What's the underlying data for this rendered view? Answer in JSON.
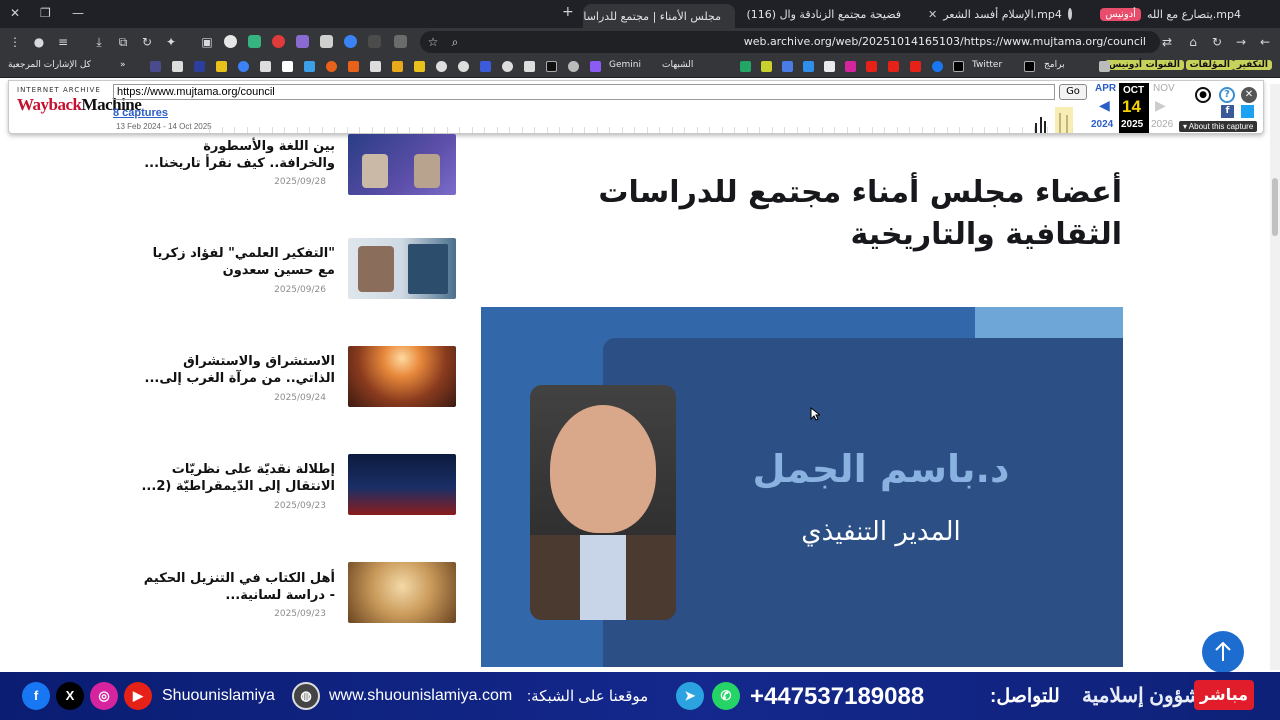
{
  "browser": {
    "tabs": [
      {
        "title": "يتصارع مع الله.mp4",
        "badge": "أدونيس"
      },
      {
        "title": "الإسلام أفسد الشعر.mp4"
      },
      {
        "title": "(116) فضيحة مجتمع الزنادقة وال"
      },
      {
        "title": "مجلس الأمناء | مجتمع للدراسات ا",
        "active": true
      }
    ],
    "new_tab": "+",
    "url": "web.archive.org/web/20251014165103/https://www.mujtama.org/council",
    "bookmarks": [
      {
        "label": "التكفير",
        "tag": true
      },
      {
        "label": "المؤلفات",
        "tag": true
      },
      {
        "label": "القنوات",
        "tag": true
      },
      {
        "label": "أدونيس",
        "tag": true
      },
      {
        "label": "برامج"
      },
      {
        "label": "Twitter"
      },
      {
        "label": "الشبهات"
      },
      {
        "label": "Gemini"
      },
      {
        "label": "كل الإشارات المرجعية"
      }
    ]
  },
  "wayback": {
    "logo_top": "INTERNET ARCHIVE",
    "logo_main_red": "Wayback",
    "logo_main_black": "Machine",
    "url_value": "https://www.mujtama.org/council",
    "go_label": "Go",
    "captures": "8 captures",
    "range": "13 Feb 2024 - 14 Oct 2025",
    "prev_month": "APR",
    "cur_month": "OCT",
    "next_month": "NOV",
    "cur_day": "14",
    "prev_year": "2024",
    "cur_year": "2025",
    "next_year": "2026",
    "about": "About this capture"
  },
  "sidebar": {
    "items": [
      {
        "title": "بين اللغة والأسطورة والخرافة.. كيف نقرأ تاريخنا...",
        "date": "2025/09/28"
      },
      {
        "title": "\"التفكير العلمي\" لفؤاد زكريا مع حسين سعدون",
        "date": "2025/09/26"
      },
      {
        "title": "الاستشراق والاستشراق الذاتي.. من مرآة الغرب إلى...",
        "date": "2025/09/24"
      },
      {
        "title": "إطلالة نقديّة على نظريّات الانتقال إلى الدّيمقراطيّة (2...",
        "date": "2025/09/23"
      },
      {
        "title": "أهل الكتاب في التنزيل الحكيم - دراسة لسانية...",
        "date": "2025/09/23"
      }
    ]
  },
  "main": {
    "title": "أعضاء مجلس أمناء مجتمع للدراسات الثقافية والتاريخية",
    "hero": {
      "name": "د.باسم الجمل",
      "role": "المدير التنفيذي"
    }
  },
  "banner": {
    "handle": "Shuounislamiya",
    "website": "www.shuounislamiya.com",
    "website_label": "موقعنا على الشبكة:",
    "phone": "+447537189088",
    "phone_label": "للتواصل:",
    "brand": "شؤون إسلامية",
    "live": "مباشر"
  },
  "colors": {
    "accent": "#1d6dd1",
    "banner": "#14288d",
    "hero_bg": "#3268aa",
    "live": "#e21d2b",
    "wayback_red": "#c8102e"
  }
}
